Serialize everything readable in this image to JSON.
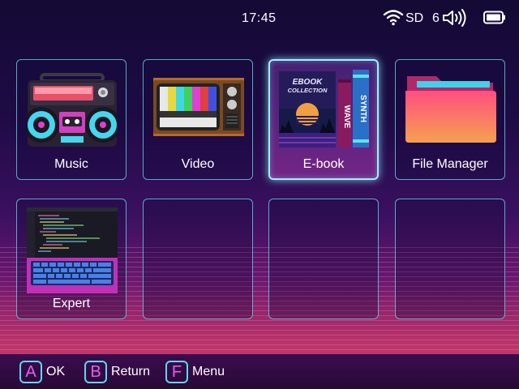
{
  "status": {
    "time": "17:45",
    "storage": "SD",
    "volume_level": "6",
    "icons": [
      "wifi-icon",
      "volume-icon",
      "battery-icon"
    ]
  },
  "apps": [
    {
      "label": "Music",
      "icon": "boombox-icon"
    },
    {
      "label": "Video",
      "icon": "retro-tv-icon"
    },
    {
      "label": "E-book",
      "icon": "book-stack-icon",
      "selected": true
    },
    {
      "label": "File Manager",
      "icon": "folder-icon"
    },
    {
      "label": "Expert",
      "icon": "laptop-code-icon"
    },
    {
      "label": "",
      "icon": ""
    },
    {
      "label": "",
      "icon": ""
    },
    {
      "label": "",
      "icon": ""
    }
  ],
  "ebook_cover": {
    "title_line1": "EBOOK",
    "title_line2": "COLLECTION",
    "spine1": "WAVE",
    "spine2": "SYNTH"
  },
  "footer": {
    "hints": [
      {
        "key": "A",
        "label": "OK"
      },
      {
        "key": "B",
        "label": "Return"
      },
      {
        "key": "F",
        "label": "Menu"
      }
    ]
  },
  "colors": {
    "accent_cyan": "#5fd6f0",
    "key_glyph": "#e060e8",
    "selected_border": "#9ef2ff"
  }
}
